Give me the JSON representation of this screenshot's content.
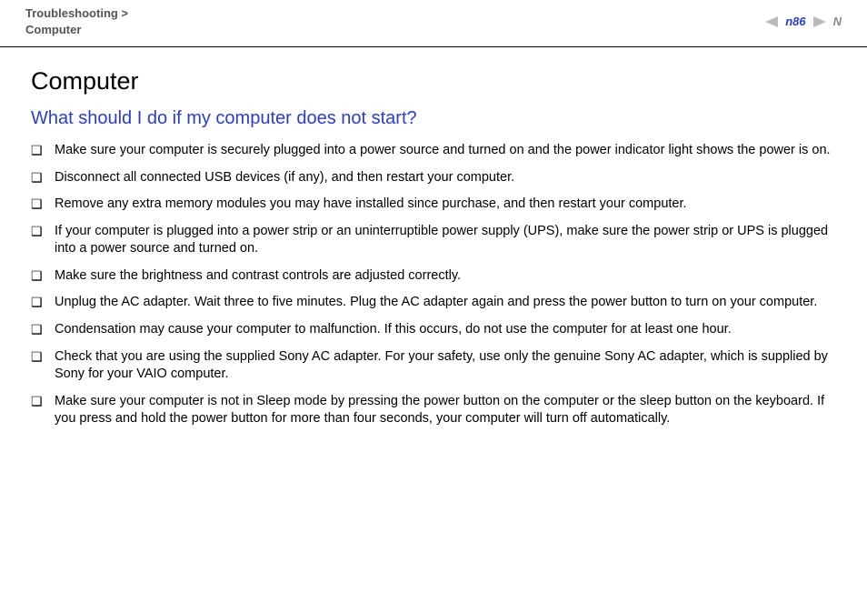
{
  "header": {
    "breadcrumb_line1": "Troubleshooting >",
    "breadcrumb_line2": "Computer",
    "page_number": "86",
    "page_indicator_prefix": "n"
  },
  "content": {
    "h1": "Computer",
    "h2": "What should I do if my computer does not start?",
    "bullets": [
      "Make sure your computer is securely plugged into a power source and turned on and the power indicator light shows the power is on.",
      "Disconnect all connected USB devices (if any), and then restart your computer.",
      "Remove any extra memory modules you may have installed since purchase, and then restart your computer.",
      "If your computer is plugged into a power strip or an uninterruptible power supply (UPS), make sure the power strip or UPS is plugged into a power source and turned on.",
      "Make sure the brightness and contrast controls are adjusted correctly.",
      "Unplug the AC adapter. Wait three to five minutes. Plug the AC adapter again and press the power button to turn on your computer.",
      "Condensation may cause your computer to malfunction. If this occurs, do not use the computer for at least one hour.",
      "Check that you are using the supplied Sony AC adapter. For your safety, use only the genuine Sony AC adapter, which is supplied by Sony for your VAIO computer.",
      "Make sure your computer is not in Sleep mode by pressing the power button on the computer or the sleep button on the keyboard. If you press and hold the power button for more than four seconds, your computer will turn off automatically."
    ]
  }
}
